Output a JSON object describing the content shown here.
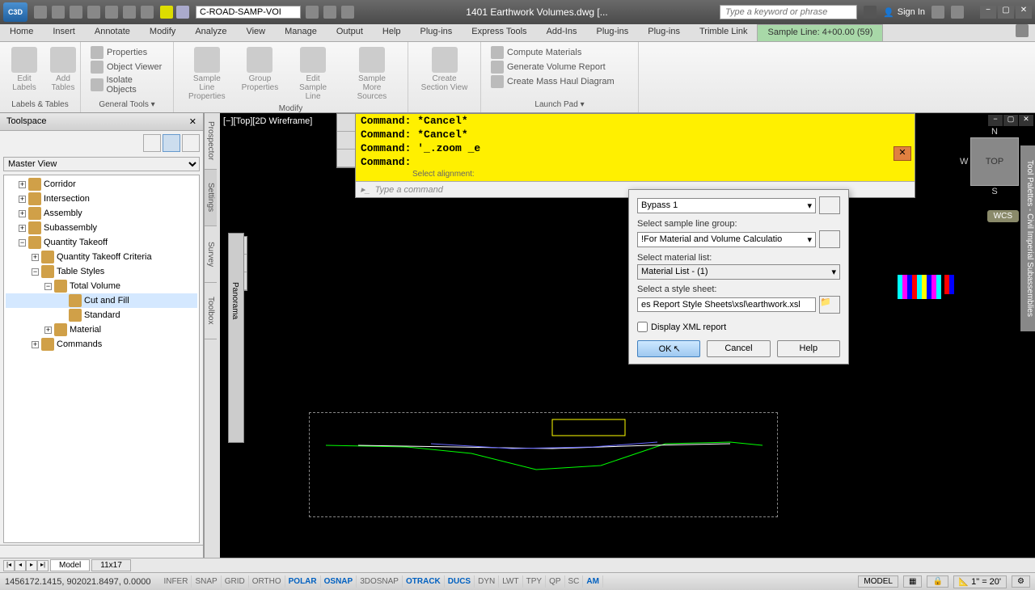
{
  "title_bar": {
    "app_id": "C3D",
    "workspace_dropdown": "C-ROAD-SAMP-VOI",
    "document_title": "1401 Earthwork Volumes.dwg [...",
    "search_placeholder": "Type a keyword or phrase",
    "signin": "Sign In"
  },
  "ribbon_tabs": [
    "Home",
    "Insert",
    "Annotate",
    "Modify",
    "Analyze",
    "View",
    "Manage",
    "Output",
    "Help",
    "Plug-ins",
    "Express Tools",
    "Add-Ins",
    "Plug-ins",
    "Plug-ins",
    "Trimble Link"
  ],
  "context_tab": "Sample Line: 4+00.00 (59)",
  "ribbon": {
    "panel1": {
      "btn1": "Edit\nLabels",
      "btn2": "Add\nTables",
      "opt1": "Properties",
      "opt2": "Object Viewer",
      "opt3": "Isolate Objects",
      "label": "Labels & Tables",
      "label2": "General Tools ▾"
    },
    "panel2": {
      "btn1": "Sample Line\nProperties",
      "btn2": "Group\nProperties",
      "btn3": "Edit\nSample Line",
      "btn4": "Sample\nMore Sources",
      "label": "Modify"
    },
    "panel3": {
      "btn1": "Create\nSection View",
      "opt1": "Compute Materials",
      "opt2": "Generate Volume Report",
      "opt3": "Create Mass Haul Diagram",
      "label": "Launch Pad ▾"
    }
  },
  "toolspace": {
    "title": "Toolspace",
    "view": "Master View",
    "tree": [
      {
        "label": "Corridor",
        "indent": 1,
        "expand": "+"
      },
      {
        "label": "Intersection",
        "indent": 1,
        "expand": "+"
      },
      {
        "label": "Assembly",
        "indent": 1,
        "expand": "+"
      },
      {
        "label": "Subassembly",
        "indent": 1,
        "expand": "+"
      },
      {
        "label": "Quantity Takeoff",
        "indent": 1,
        "expand": "−"
      },
      {
        "label": "Quantity Takeoff Criteria",
        "indent": 2,
        "expand": "+"
      },
      {
        "label": "Table Styles",
        "indent": 2,
        "expand": "−"
      },
      {
        "label": "Total Volume",
        "indent": 3,
        "expand": "−"
      },
      {
        "label": "Cut and Fill",
        "indent": 4,
        "selected": true
      },
      {
        "label": "Standard",
        "indent": 4
      },
      {
        "label": "Material",
        "indent": 3,
        "expand": "+"
      },
      {
        "label": "Commands",
        "indent": 2,
        "expand": "+"
      }
    ],
    "side_tabs": [
      "Prospector",
      "Settings",
      "Survey",
      "Toolbox"
    ],
    "panorama_tab": "Panorama"
  },
  "drawing": {
    "viewport_label": "[−][Top][2D Wireframe]",
    "viewcube": "TOP",
    "wcs": "WCS",
    "palette_label": "Tool Palettes - Civil Imperial Subassemblies"
  },
  "command_window": {
    "lines": [
      "Command: *Cancel*",
      "Command: *Cancel*",
      "Command: '_.zoom _e",
      "Command:"
    ],
    "hint_above": "Select alignment:",
    "prompt": "Type a command"
  },
  "dialog": {
    "alignment_value": "Bypass 1",
    "label_sample_group": "Select sample line group:",
    "sample_group_value": "!For Material and Volume Calculatio",
    "label_material": "Select material list:",
    "material_value": "Material List - (1)",
    "label_style": "Select a style sheet:",
    "style_value": "es Report Style Sheets\\xsl\\earthwork.xsl",
    "checkbox": "Display XML report",
    "ok": "OK",
    "cancel": "Cancel",
    "help": "Help"
  },
  "model_tabs": {
    "active": "Model",
    "other": "11x17"
  },
  "statusbar": {
    "coords": "1456172.1415, 902021.8497, 0.0000",
    "toggles": [
      "INFER",
      "SNAP",
      "GRID",
      "ORTHO",
      "POLAR",
      "OSNAP",
      "3DOSNAP",
      "OTRACK",
      "DUCS",
      "DYN",
      "LWT",
      "TPY",
      "QP",
      "SC",
      "AM"
    ],
    "active_toggles": [
      "POLAR",
      "OSNAP",
      "OTRACK",
      "DUCS",
      "AM"
    ],
    "right": {
      "model": "MODEL",
      "scale": "1\" = 20'"
    }
  }
}
